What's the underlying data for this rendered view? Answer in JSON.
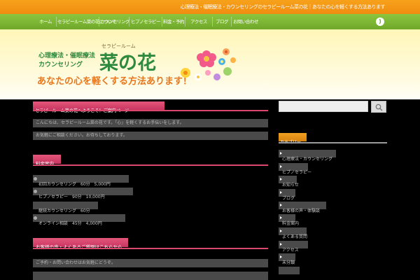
{
  "topbar": {
    "text": "心理療法・催眠療法・カウンセリングのセラピールーム菜の花｜あなたの心を軽くする方法あります"
  },
  "nav": {
    "items": [
      {
        "label": "ホーム"
      },
      {
        "label": "セラピールーム菜の花について"
      },
      {
        "label": "カウンセリング"
      },
      {
        "label": "ヒプノセラピー"
      },
      {
        "label": "料金・予約"
      },
      {
        "label": "アクセス"
      },
      {
        "label": "ブログ"
      },
      {
        "label": "お問い合わせ"
      }
    ]
  },
  "header": {
    "tagline_top": "心理療法・催眠療法",
    "tagline_bottom": "カウンセリング",
    "brand_sub": "セラピールーム",
    "brand": "菜の花",
    "slogan": "あなたの心を軽くする方法あります！"
  },
  "main": {
    "page_title": "セラピールーム菜の花へようこそ！ご案内ページ",
    "intro_line1": "こんにちは、セラピールーム菜の花です。「心」を軽くするお手伝いをします。",
    "intro_line2": "お気軽にご相談ください。お待ちしております。",
    "section1_title": "料金案内",
    "list": [
      "初回カウンセリング　60分　5,000円",
      "ヒプノセラピー　90分　10,000円",
      "継続カウンセリング　60分",
      "オンライン相談　45分　4,000円"
    ],
    "section2_title": "お客様の声・よくあるご質問はこちらから",
    "footer_line": "ご予約・お問い合わせはお気軽にどうぞ。"
  },
  "sidebar": {
    "search_placeholder": "",
    "heading": "カテゴリー",
    "items": [
      {
        "label": "心理療法・カウンセリング"
      },
      {
        "label": "ヒプノセラピー"
      },
      {
        "label": "お知らせ"
      },
      {
        "label": "ブログ"
      },
      {
        "label": "お客様の声・体験談"
      },
      {
        "label": "料金案内"
      },
      {
        "label": "よくある質問"
      },
      {
        "label": "アクセス"
      },
      {
        "label": "未分類"
      }
    ]
  },
  "colors": {
    "topbar": "#f08c10",
    "nav": "#6fa82a",
    "accent_pink": "#c93561",
    "accent_green": "#2d8a3e",
    "accent_orange": "#e8761d"
  }
}
